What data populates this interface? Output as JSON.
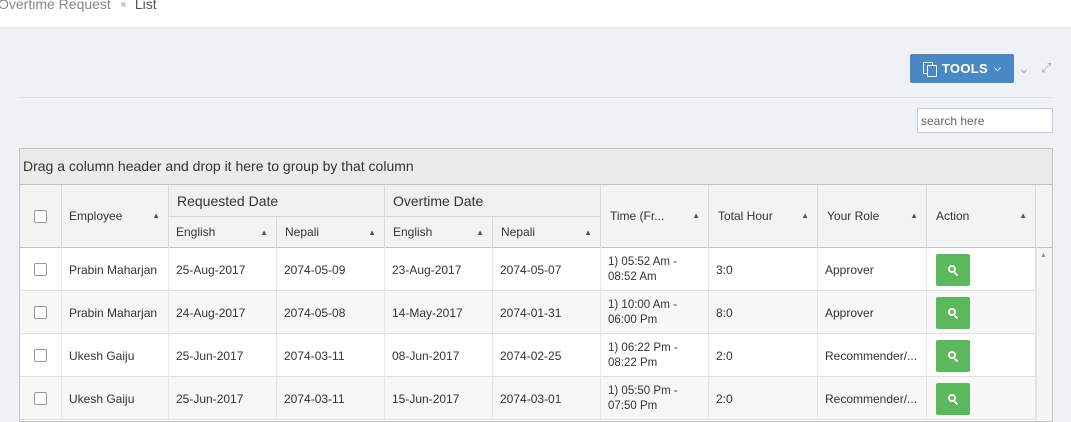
{
  "breadcrumb": {
    "parent": "Overtime Request",
    "current": "List"
  },
  "toolbar": {
    "tools_label": "TOOLS"
  },
  "search": {
    "placeholder": "search here"
  },
  "grid": {
    "group_hint": "Drag a column header and drop it here to group by that column",
    "headers": {
      "employee": "Employee",
      "requested_date": "Requested Date",
      "overtime_date": "Overtime Date",
      "english": "English",
      "nepali": "Nepali",
      "time": "Time (Fr...",
      "total_hour": "Total Hour",
      "your_role": "Your Role",
      "action": "Action"
    },
    "rows": [
      {
        "employee": "Prabin Maharjan",
        "req_en": "25-Aug-2017",
        "req_np": "2074-05-09",
        "ot_en": "23-Aug-2017",
        "ot_np": "2074-05-07",
        "time": "1) 05:52 Am - 08:52 Am",
        "hours": "3:0",
        "role": "Approver"
      },
      {
        "employee": "Prabin Maharjan",
        "req_en": "24-Aug-2017",
        "req_np": "2074-05-08",
        "ot_en": "14-May-2017",
        "ot_np": "2074-01-31",
        "time": "1) 10:00 Am - 06:00 Pm",
        "hours": "8:0",
        "role": "Approver"
      },
      {
        "employee": "Ukesh Gaiju",
        "req_en": "25-Jun-2017",
        "req_np": "2074-03-11",
        "ot_en": "08-Jun-2017",
        "ot_np": "2074-02-25",
        "time": "1) 06:22 Pm - 08:22 Pm",
        "hours": "2:0",
        "role": "Recommender/..."
      },
      {
        "employee": "Ukesh Gaiju",
        "req_en": "25-Jun-2017",
        "req_np": "2074-03-11",
        "ot_en": "15-Jun-2017",
        "ot_np": "2074-03-01",
        "time": "1) 05:50 Pm - 07:50 Pm",
        "hours": "2:0",
        "role": "Recommender/..."
      }
    ]
  },
  "colors": {
    "tools_button": "#4a87c5",
    "action_button": "#5cb85c"
  }
}
